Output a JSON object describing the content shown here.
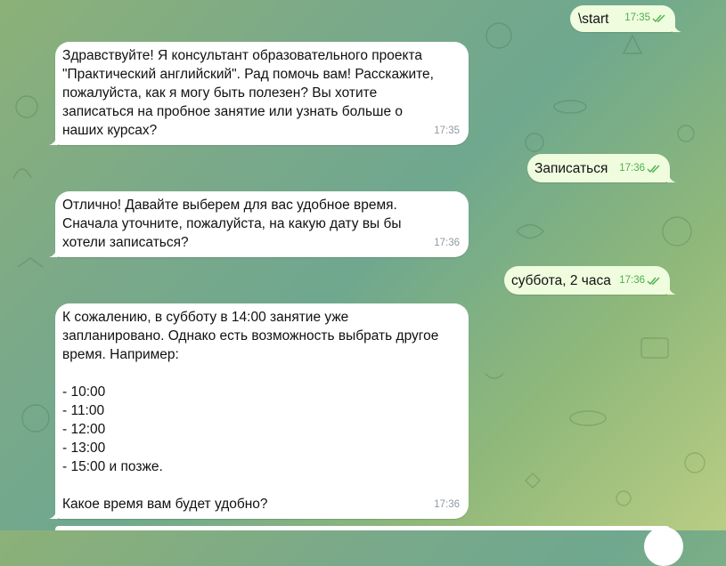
{
  "messages": [
    {
      "direction": "out",
      "text": "\\start",
      "time": "17:35",
      "read": true
    },
    {
      "direction": "in",
      "text": "Здравствуйте! Я консультант образовательного проекта\n\"Практический английский\". Рад помочь вам! Расскажите,\nпожалуйста, как я могу быть полезен? Вы хотите\nзаписаться на пробное занятие или узнать больше о\nнаших курсах?",
      "time": "17:35"
    },
    {
      "direction": "out",
      "text": "Записаться",
      "time": "17:36",
      "read": true
    },
    {
      "direction": "in",
      "text": "Отлично! Давайте выберем для вас удобное время.\nСначала уточните, пожалуйста, на какую дату вы бы\nхотели записаться?",
      "time": "17:36"
    },
    {
      "direction": "out",
      "text": "суббота, 2 часа",
      "time": "17:36",
      "read": true
    },
    {
      "direction": "in",
      "text": "К сожалению, в субботу в 14:00 занятие уже\nзапланировано. Однако есть возможность выбрать другое\nвремя. Например:\n\n- 10:00\n- 11:00\n- 12:00\n- 13:00\n- 15:00 и позже.\n\nКакое время вам будет удобно?",
      "time": "17:36"
    }
  ],
  "colors": {
    "incoming_bubble": "#ffffff",
    "outgoing_bubble": "#effdde",
    "read_check": "#4fae4e",
    "time_incoming": "#8e9aa3"
  }
}
